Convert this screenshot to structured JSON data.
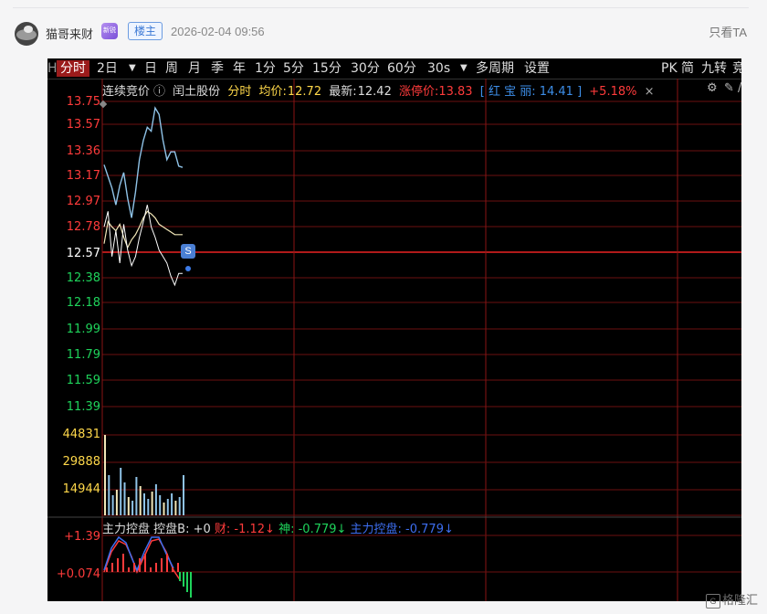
{
  "post": {
    "username": "猫哥来财",
    "vip_badge": "新锐",
    "role_badge": "楼主",
    "timestamp": "2026-02-04 09:56",
    "only_ta": "只看TA"
  },
  "toolbar": {
    "items": [
      "分时",
      "2日",
      "日",
      "周",
      "月",
      "季",
      "年",
      "1分",
      "5分",
      "15分",
      "30分",
      "60分",
      "30s",
      "多周期",
      "设置"
    ],
    "active": "分时",
    "right_items": [
      "PK",
      "简",
      "九转",
      "竞"
    ]
  },
  "header": {
    "mode": "连续竞价",
    "stock_name": "闰土股份",
    "view": "分时",
    "avg_label": "均价:",
    "avg_value": "12.72",
    "latest_label": "最新:",
    "latest_value": "12.42",
    "limit_up_label": "涨停价:13.83",
    "indicator_text": "[ 红 宝 丽: 14.41 ]",
    "indicator_change": "+5.18%",
    "close_glyph": "×"
  },
  "price_axis": [
    "13.75",
    "13.57",
    "13.36",
    "13.17",
    "12.97",
    "12.78",
    "12.57",
    "12.38",
    "12.18",
    "11.99",
    "11.79",
    "11.59",
    "11.39"
  ],
  "volume_axis": [
    "44831",
    "29888",
    "14944"
  ],
  "sub_indicator": {
    "title": "主力控盘",
    "ctrl_b": "控盘B: +0",
    "cai": "财: -1.12↓",
    "shen": "神: -0.779↓",
    "main_ctrl": "主力控盘: -0.779↓"
  },
  "sub_axis": [
    "+1.39",
    "+0.074"
  ],
  "marker": "S",
  "colors": {
    "up": "#ff3b3b",
    "down": "#1fd35b",
    "neutral": "#ffffff",
    "price_line": "#8fc3e8",
    "avg_line": "#f2e7b8",
    "grid": "#6b0f0f",
    "accent_blue": "#3d8ee8"
  },
  "chart_data": {
    "type": "line",
    "series": [
      {
        "name": "最新",
        "values": [
          13.26,
          13.17,
          13.08,
          12.95,
          13.1,
          13.2,
          13.0,
          12.85,
          13.05,
          13.3,
          13.45,
          13.55,
          13.52,
          13.7,
          13.65,
          13.45,
          13.3,
          13.36,
          13.36,
          13.25,
          13.24
        ]
      },
      {
        "name": "均价",
        "values": [
          12.65,
          12.82,
          12.78,
          12.75,
          12.8,
          12.7,
          12.62,
          12.68,
          12.72,
          12.78,
          12.85,
          12.9,
          12.88,
          12.85,
          12.8,
          12.78,
          12.76,
          12.74,
          12.72,
          12.72,
          12.72
        ]
      }
    ],
    "volumes": [
      44000,
      22000,
      11000,
      14000,
      26000,
      18000,
      10000,
      8000,
      21000,
      16000,
      12000,
      9000,
      13000,
      17000,
      11000,
      7000,
      9000,
      12000,
      8000,
      10000,
      22000
    ],
    "ylim": [
      11.39,
      13.75
    ]
  },
  "watermark": "格隆汇"
}
